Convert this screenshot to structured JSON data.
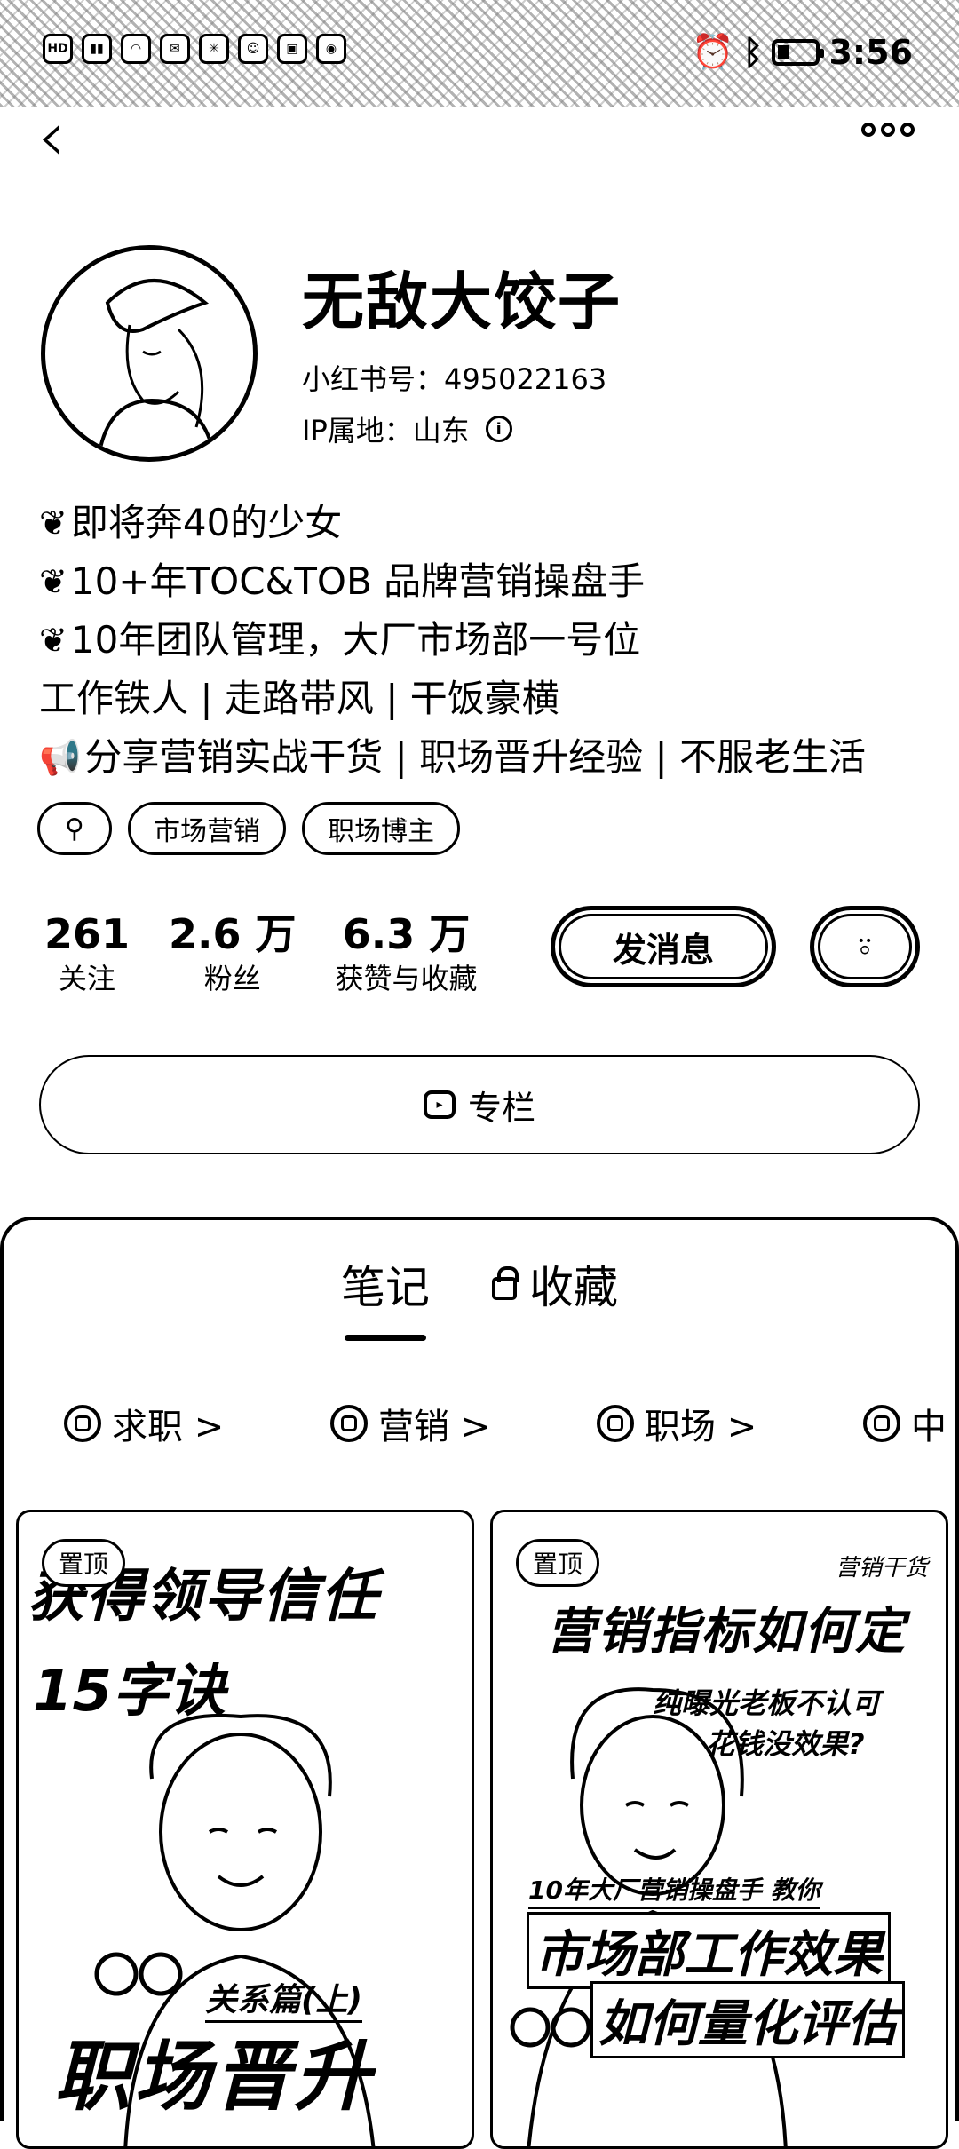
{
  "status_bar": {
    "left_icons": [
      "HD",
      "4G",
      "wifi",
      "msg",
      "app",
      "chat",
      "app2",
      "weibo"
    ],
    "time": "3:56"
  },
  "profile": {
    "name": "无敌大饺子",
    "red_id": "小红书号：495022163",
    "ip_label": "IP属地：山东"
  },
  "bio": [
    {
      "icon": "leaf",
      "text": "即将奔40的少女"
    },
    {
      "icon": "leaf",
      "text": "10+年TOC&TOB 品牌营销操盘手"
    },
    {
      "icon": "leaf",
      "text": "10年团队管理，大厂市场部一号位"
    },
    {
      "icon": "",
      "text": "工作铁人 | 走路带风 | 干饭豪横"
    },
    {
      "icon": "megaphone",
      "text": "分享营销实战干货 | 职场晋升经验 | 不服老生活"
    }
  ],
  "tags": [
    "市场营销",
    "职场博主"
  ],
  "stats": [
    {
      "num": "261",
      "label": "关注"
    },
    {
      "num": "2.6 万",
      "label": "粉丝"
    },
    {
      "num": "6.3 万",
      "label": "获赞与收藏"
    }
  ],
  "actions": {
    "message": "发消息",
    "column": "专栏"
  },
  "tabs": {
    "notes": "笔记",
    "favorites": "收藏"
  },
  "collections": [
    "求职 >",
    "营销 >",
    "职场 >",
    "中"
  ],
  "cards": [
    {
      "pin": "置顶",
      "headline": "获得领导信任",
      "sub": "15字诀",
      "tag": "关系篇(上)",
      "footer": "职场晋升"
    },
    {
      "pin": "置顶",
      "brand": "营销干货",
      "headline": "营销指标如何定",
      "sub1": "纯曝光老板不认可",
      "sub2": "花钱没效果?",
      "sub3": "10年大厂营销操盘手 教你",
      "footer1": "市场部工作效果",
      "footer2": "如何量化评估"
    }
  ]
}
